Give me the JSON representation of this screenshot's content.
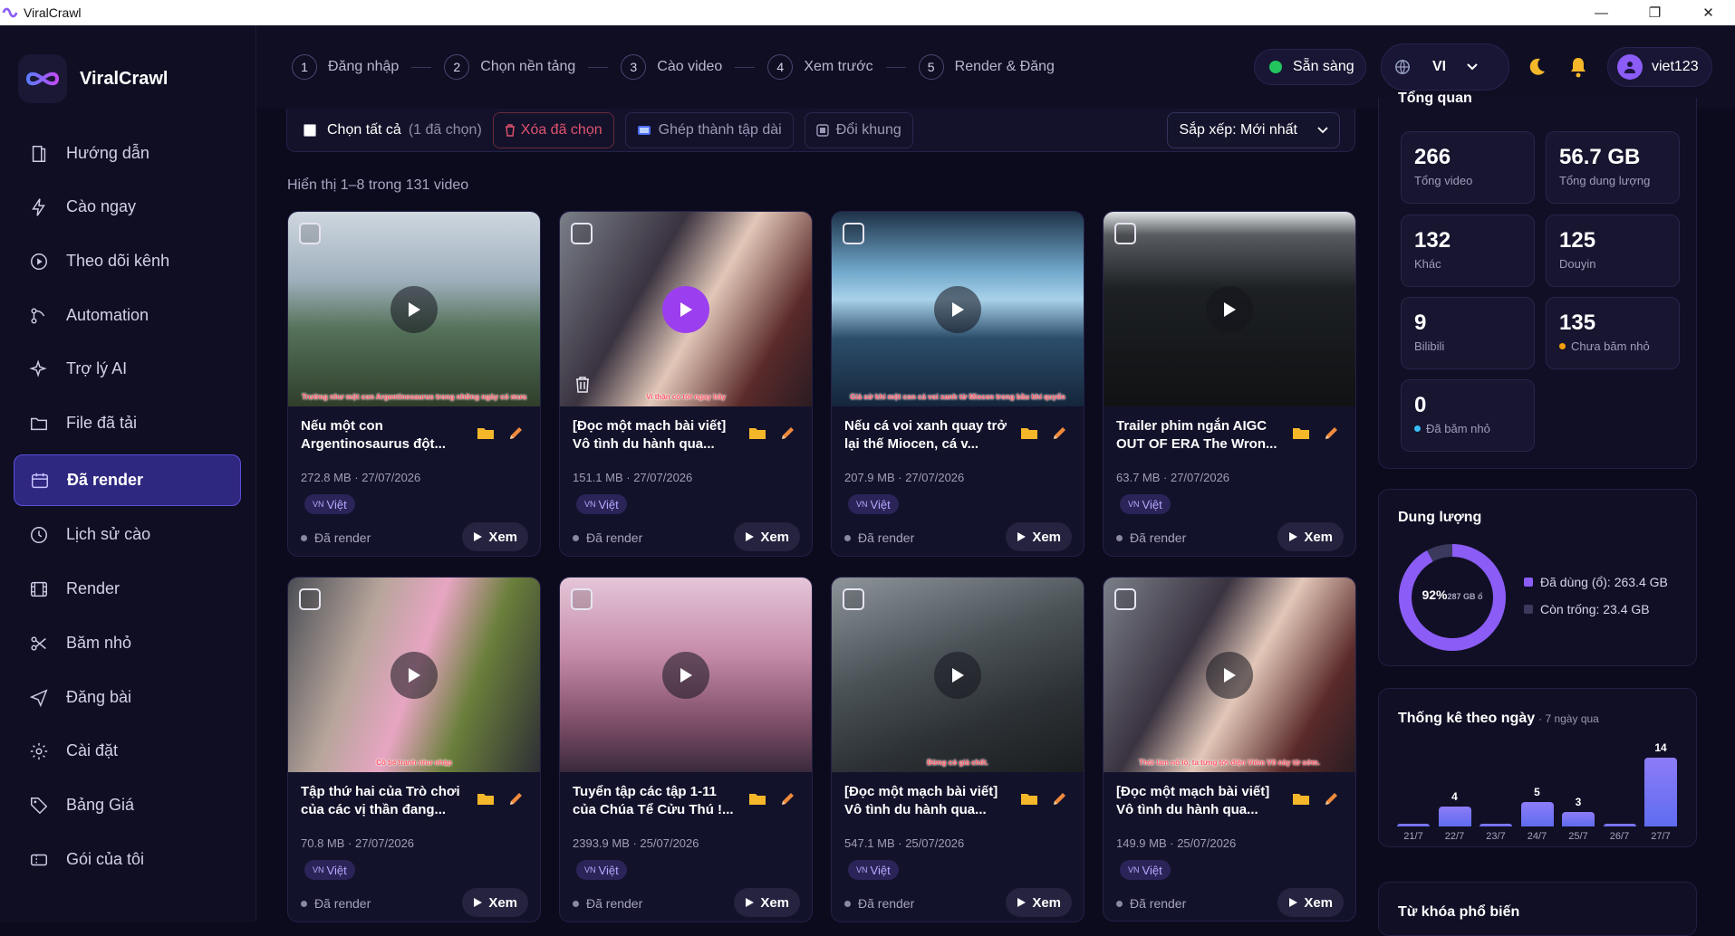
{
  "window": {
    "title": "ViralCrawl",
    "min": "—",
    "max": "❐",
    "close": "✕"
  },
  "brand": {
    "name": "ViralCrawl"
  },
  "sidebar": {
    "items": [
      {
        "label": "Hướng dẫn",
        "icon": "book-icon"
      },
      {
        "label": "Cào ngay",
        "icon": "bolt-icon"
      },
      {
        "label": "Theo dõi kênh",
        "icon": "play-circle-icon"
      },
      {
        "label": "Automation",
        "icon": "flow-icon"
      },
      {
        "label": "Trợ lý AI",
        "icon": "sparkle-icon"
      },
      {
        "label": "File đã tải",
        "icon": "folder-icon"
      },
      {
        "label": "Đã render",
        "icon": "calendar-icon",
        "active": true
      },
      {
        "label": "Lịch sử cào",
        "icon": "clock-icon"
      },
      {
        "label": "Render",
        "icon": "film-icon"
      },
      {
        "label": "Băm nhỏ",
        "icon": "scissors-icon"
      },
      {
        "label": "Đăng bài",
        "icon": "send-icon"
      },
      {
        "label": "Cài đặt",
        "icon": "gear-icon"
      },
      {
        "label": "Bảng Giá",
        "icon": "tag-icon"
      },
      {
        "label": "Gói của tôi",
        "icon": "ticket-icon"
      }
    ]
  },
  "steps": [
    {
      "num": "1",
      "label": "Đăng nhập"
    },
    {
      "num": "2",
      "label": "Chọn nền tảng"
    },
    {
      "num": "3",
      "label": "Cào video"
    },
    {
      "num": "4",
      "label": "Xem trước"
    },
    {
      "num": "5",
      "label": "Render & Đăng"
    }
  ],
  "header": {
    "status": "Sẵn sàng",
    "lang": "VI",
    "username": "viet123",
    "status_color": "#22c55e"
  },
  "toolbar": {
    "select_all": "Chọn tất cả",
    "selected_count": "(1 đã chọn)",
    "delete_selected": "Xóa đã chọn",
    "merge": "Ghép thành tập dài",
    "reframe": "Đổi khung",
    "sort": "Sắp xếp: Mới nhất"
  },
  "list": {
    "count_text": "Hiển thị 1–8 trong 131 video"
  },
  "cards": [
    {
      "title": "Nếu một con Argentinosaurus đột...",
      "meta": "272.8 MB · 27/07/2026",
      "lang": "Việt",
      "flag": "VN",
      "status": "Đã render",
      "view": "Xem",
      "caption": "Trường như một con Argentinosaurus trong những ngày có mưa",
      "theme": "dino"
    },
    {
      "title": "[Đọc một mạch bài viết] Vô tình du hành qua...",
      "meta": "151.1 MB · 27/07/2026",
      "lang": "Việt",
      "flag": "VN",
      "status": "Đã render",
      "view": "Xem",
      "caption": "Vi thận có tới ngay bây",
      "theme": "fantasy"
    },
    {
      "title": "Nếu cá voi xanh quay trở lại thế Miocen, cá v...",
      "meta": "207.9 MB · 27/07/2026",
      "lang": "Việt",
      "flag": "VN",
      "status": "Đã render",
      "view": "Xem",
      "caption": "Giả sử khi một con cá voi xanh từ Miocen trong bầu khí quyển",
      "theme": "ocean"
    },
    {
      "title": "Trailer phim ngắn AIGC OUT OF ERA The Wron...",
      "meta": "63.7 MB · 27/07/2026",
      "lang": "Việt",
      "flag": "VN",
      "status": "Đã render",
      "view": "Xem",
      "caption": "",
      "theme": "dark"
    },
    {
      "title": "Tập thứ hai của Trò chơi của các vị thần đang...",
      "meta": "70.8 MB · 27/07/2026",
      "lang": "Việt",
      "flag": "VN",
      "status": "Đã render",
      "view": "Xem",
      "caption": "Cô bé tranh như nhập",
      "theme": "anime"
    },
    {
      "title": "Tuyển tập các tập 1-11 của Chúa Tể Cửu Thú !...",
      "meta": "2393.9 MB · 25/07/2026",
      "lang": "Việt",
      "flag": "VN",
      "status": "Đã render",
      "view": "Xem",
      "caption": "",
      "theme": "pink"
    },
    {
      "title": "[Đọc một mạch bài viết] Vô tình du hành qua...",
      "meta": "547.1 MB · 25/07/2026",
      "lang": "Việt",
      "flag": "VN",
      "status": "Đã render",
      "view": "Xem",
      "caption": "Đừng có giả chết.",
      "theme": "gray"
    },
    {
      "title": "[Đọc một mạch bài viết] Vô tình du hành qua...",
      "meta": "149.9 MB · 25/07/2026",
      "lang": "Việt",
      "flag": "VN",
      "status": "Đã render",
      "view": "Xem",
      "caption": "Thôi làm nổ lộ, ta từng tới điện Viêm Võ này từ sớm.",
      "theme": "fantasy"
    }
  ],
  "overview": {
    "title": "Tổng quan",
    "stats": [
      {
        "value": "266",
        "label": "Tổng video"
      },
      {
        "value": "56.7 GB",
        "label": "Tổng dung lượng"
      },
      {
        "value": "132",
        "label": "Khác"
      },
      {
        "value": "125",
        "label": "Douyin"
      },
      {
        "value": "9",
        "label": "Bilibili"
      },
      {
        "value": "135",
        "label": "Chưa băm nhỏ",
        "dot": "#f59e0b"
      },
      {
        "value": "0",
        "label": "Đã băm nhỏ",
        "dot": "#38bdf8"
      }
    ]
  },
  "storage": {
    "title": "Dung lượng",
    "percent": 92,
    "percent_label": "92%",
    "total_label": "287 GB ổ",
    "used_label": "Đã dùng (ổ): 263.4 GB",
    "free_label": "Còn trống: 23.4 GB",
    "used_color": "#8b5cf6",
    "free_color": "#3b3a5c"
  },
  "daily": {
    "title": "Thống kê theo ngày",
    "subtitle": "· 7 ngày qua"
  },
  "chart_data": {
    "type": "bar",
    "categories": [
      "21/7",
      "22/7",
      "23/7",
      "24/7",
      "25/7",
      "26/7",
      "27/7"
    ],
    "values": [
      0,
      4,
      0,
      5,
      3,
      0,
      14
    ],
    "labels": [
      "",
      "4",
      "",
      "5",
      "3",
      "",
      "14"
    ],
    "title": "Thống kê theo ngày",
    "subtitle": "7 ngày qua",
    "ylim": [
      0,
      14
    ],
    "grid": false,
    "color": "#7c6cf0"
  },
  "keywords": {
    "title": "Từ khóa phổ biến"
  }
}
